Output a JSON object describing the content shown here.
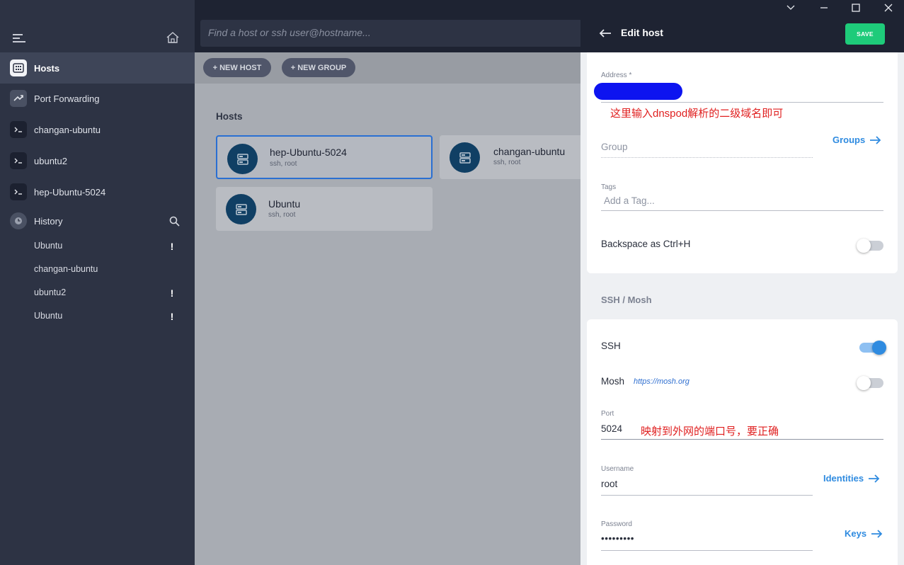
{
  "sidebar": {
    "items": [
      {
        "label": "Hosts",
        "icon": "hosts-grid-icon"
      },
      {
        "label": "Port Forwarding",
        "icon": "port-forward-icon"
      },
      {
        "label": "changan-ubuntu",
        "icon": "terminal-icon"
      },
      {
        "label": "ubuntu2",
        "icon": "terminal-icon"
      },
      {
        "label": "hep-Ubuntu-5024",
        "icon": "terminal-icon"
      },
      {
        "label": "History",
        "icon": "clock-icon"
      }
    ],
    "history": [
      {
        "label": "Ubuntu",
        "warn": "!"
      },
      {
        "label": "changan-ubuntu",
        "warn": ""
      },
      {
        "label": "ubuntu2",
        "warn": "!"
      },
      {
        "label": "Ubuntu",
        "warn": "!"
      }
    ]
  },
  "search": {
    "placeholder": "Find a host or ssh user@hostname..."
  },
  "toolbar": {
    "new_host": "+ NEW HOST",
    "new_group": "+ NEW GROUP"
  },
  "hosts": {
    "title": "Hosts",
    "cards": [
      {
        "name": "hep-Ubuntu-5024",
        "sub": "ssh, root"
      },
      {
        "name": "changan-ubuntu",
        "sub": "ssh, root"
      },
      {
        "name": "Ubuntu",
        "sub": "ssh, root"
      }
    ]
  },
  "panel": {
    "title": "Edit host",
    "save": "SAVE",
    "address_label": "Address *",
    "address_note": "这里输入dnspod解析的二级域名即可",
    "group_placeholder": "Group",
    "groups_link": "Groups",
    "tags_label": "Tags",
    "tags_placeholder": "Add a Tag...",
    "backspace_label": "Backspace as Ctrl+H",
    "backspace_on": false,
    "section_ssh": "SSH / Mosh",
    "ssh_label": "SSH",
    "ssh_on": true,
    "mosh_label": "Mosh",
    "mosh_link": "https://mosh.org",
    "mosh_on": false,
    "port_label": "Port",
    "port_value": "5024",
    "port_note": "映射到外网的端口号，要正确",
    "username_label": "Username",
    "username_value": "root",
    "identities_link": "Identities",
    "password_label": "Password",
    "password_value": "•••••••••",
    "keys_link": "Keys"
  },
  "colors": {
    "accent": "#2f8be0",
    "save": "#1ecb7a",
    "sidebar": "#2d3344",
    "annotation": "#e01f1f"
  }
}
